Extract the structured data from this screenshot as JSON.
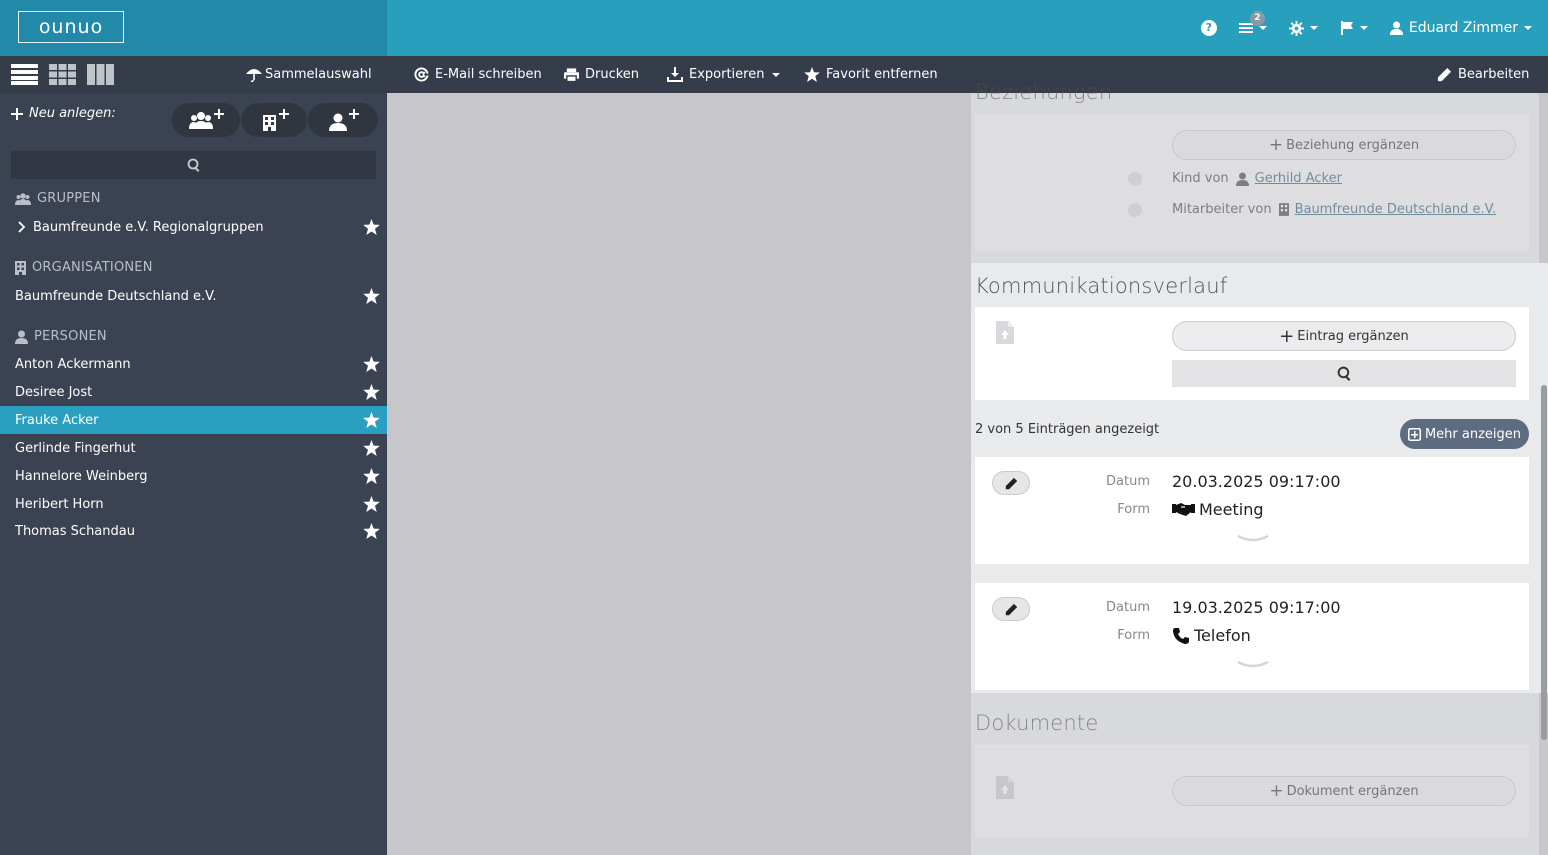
{
  "app": {
    "logo": "ounuo"
  },
  "topbar": {
    "notifications_count": "2",
    "user_name": "Eduard Zimmer",
    "help_glyph": "?"
  },
  "toolbar": {
    "bulk_select": "Sammelauswahl",
    "email": "E-Mail schreiben",
    "print": "Drucken",
    "export": "Exportieren",
    "favorite_remove": "Favorit entfernen",
    "edit": "Bearbeiten"
  },
  "sidebar": {
    "new_label": "Neu anlegen:",
    "groups_heading": "GRUPPEN",
    "groups": [
      {
        "label": "Baumfreunde e.V. Regionalgruppen"
      }
    ],
    "orgs_heading": "ORGANISATIONEN",
    "orgs": [
      {
        "label": "Baumfreunde Deutschland e.V."
      }
    ],
    "persons_heading": "PERSONEN",
    "persons": [
      {
        "label": "Anton Ackermann"
      },
      {
        "label": "Desiree Jost"
      },
      {
        "label": "Frauke Acker",
        "active": true
      },
      {
        "label": "Gerlinde Fingerhut"
      },
      {
        "label": "Hannelore Weinberg"
      },
      {
        "label": "Heribert Horn"
      },
      {
        "label": "Thomas Schandau"
      }
    ]
  },
  "relations": {
    "title": "Beziehungen",
    "add_label": "Beziehung ergänzen",
    "rows": [
      {
        "prefix": "Kind von",
        "link": "Gerhild Acker"
      },
      {
        "prefix": "Mitarbeiter von",
        "link": "Baumfreunde Deutschland e.V."
      }
    ]
  },
  "communication": {
    "title": "Kommunikationsverlauf",
    "add_label": "Eintrag ergänzen",
    "summary": "2 von 5 Einträgen angezeigt",
    "more_label": "Mehr anzeigen",
    "date_label": "Datum",
    "form_label": "Form",
    "entries": [
      {
        "date": "20.03.2025 09:17:00",
        "form": "Meeting"
      },
      {
        "date": "19.03.2025 09:17:00",
        "form": "Telefon"
      }
    ]
  },
  "documents": {
    "title": "Dokumente",
    "add_label": "Dokument ergänzen"
  },
  "icons": {
    "help": "question-circle-icon",
    "list": "list-icon",
    "settings": "gear-icon",
    "flag": "flag-icon",
    "user": "user-icon",
    "view_list": "view-list-icon",
    "view_grid": "view-grid-icon",
    "view_columns": "view-columns-icon",
    "umbrella": "umbrella-icon",
    "at": "at-icon",
    "print": "printer-icon",
    "download": "download-icon",
    "star": "star-icon",
    "pencil": "pencil-icon"
  },
  "colors": {
    "topbar": "#289fbc",
    "logo_bg": "#2389a8",
    "toolbar": "#353c4a",
    "sidebar": "#3b4252",
    "active_item": "#2a9fc0",
    "link": "#2b5f7a"
  }
}
